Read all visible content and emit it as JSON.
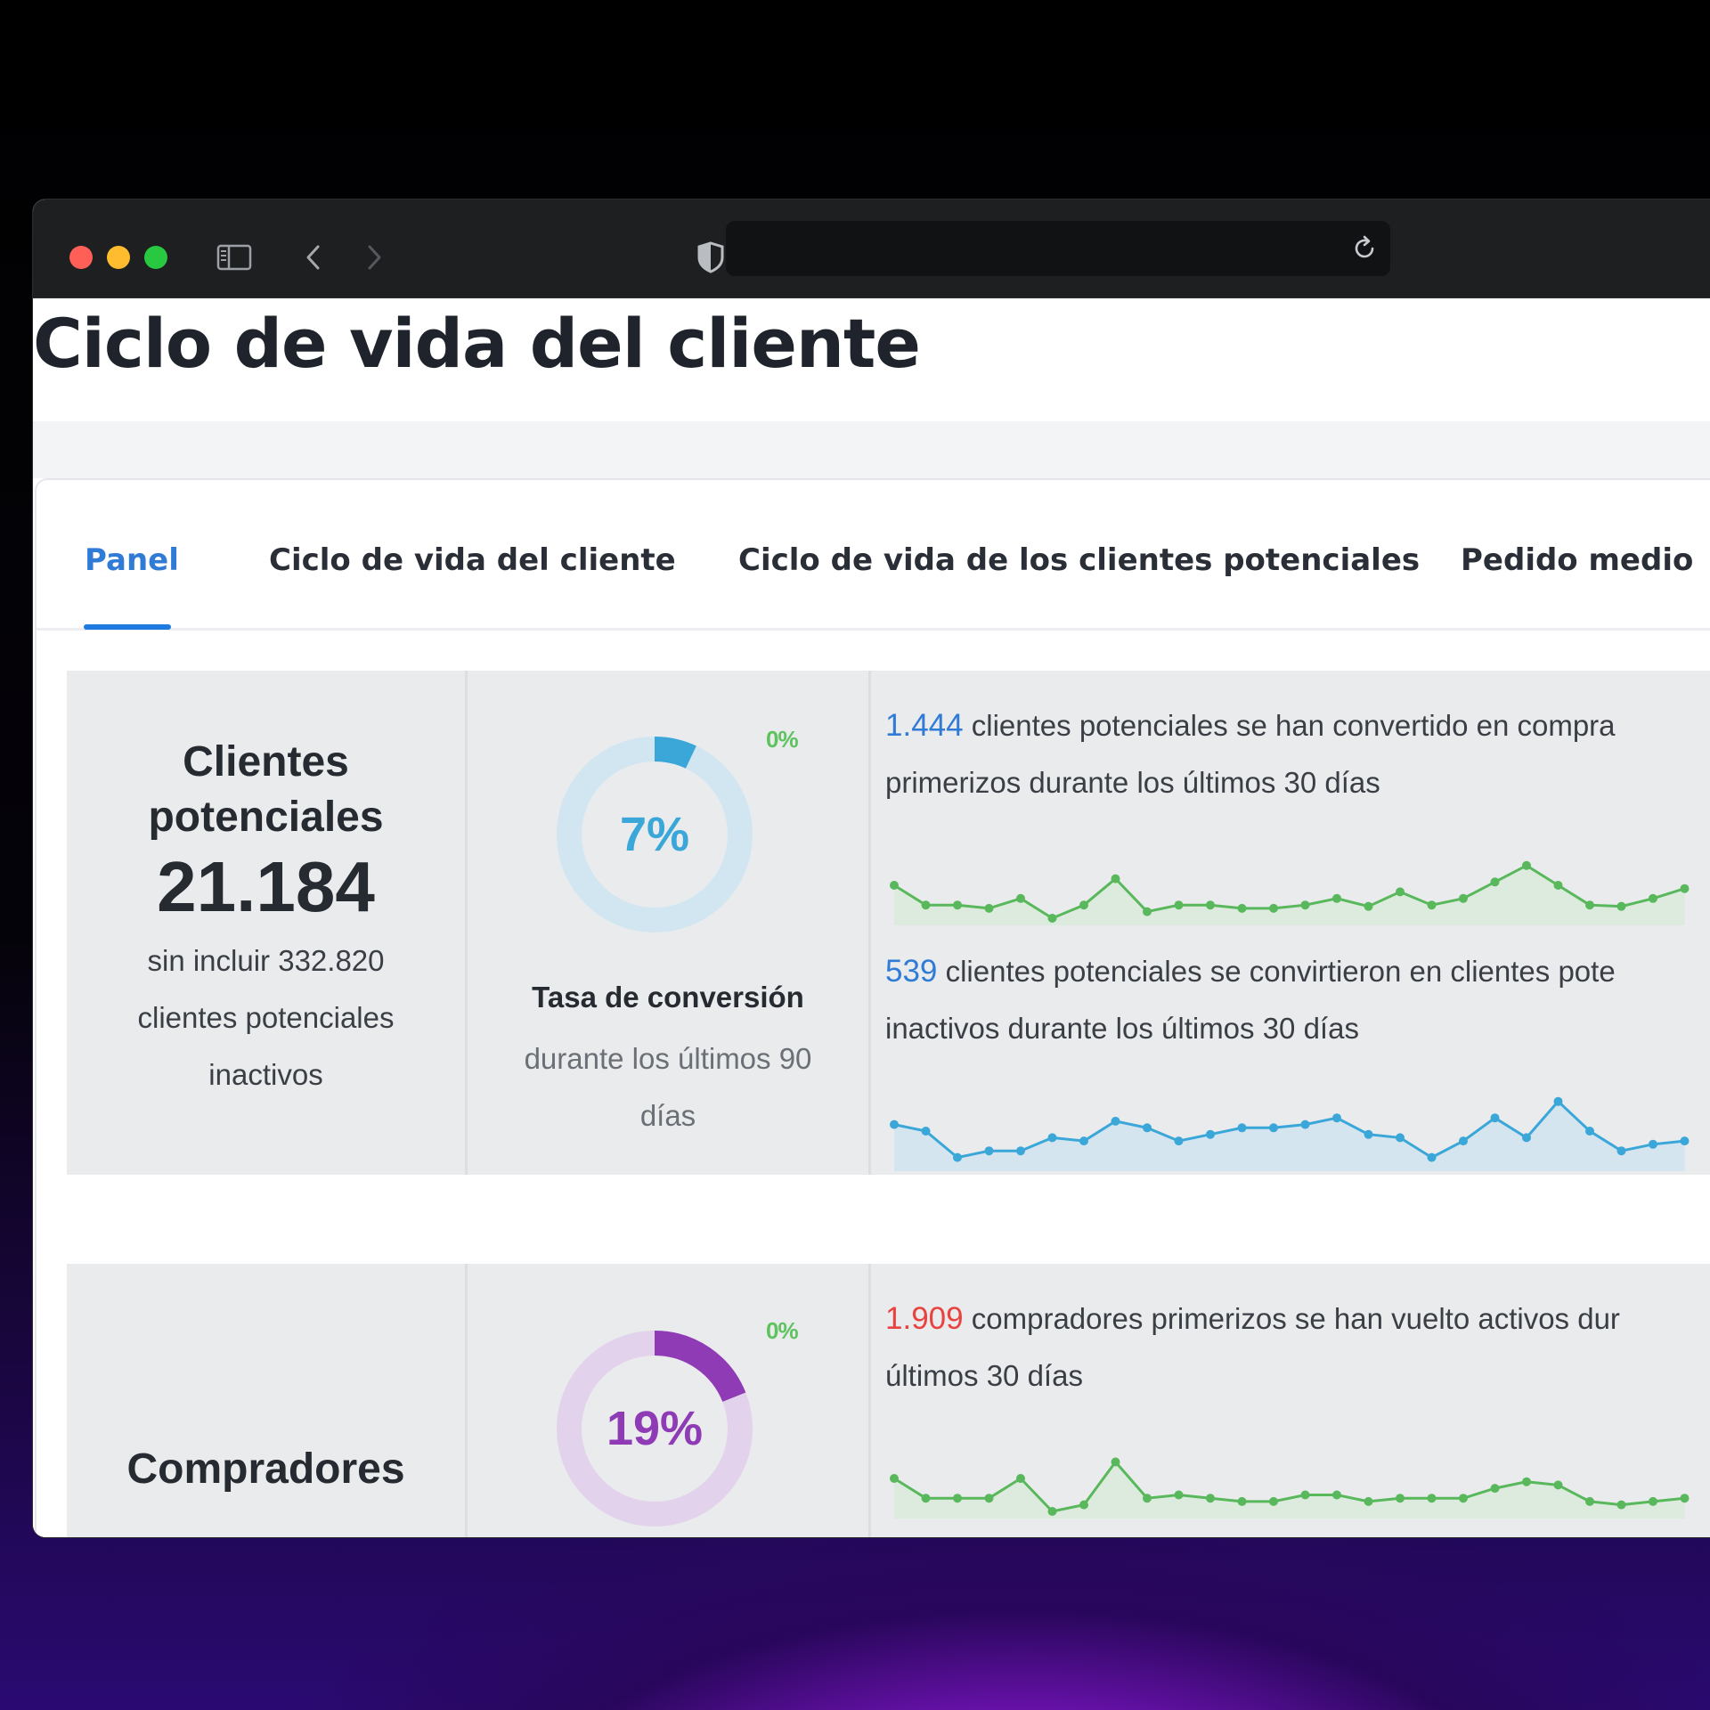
{
  "page": {
    "title": "Ciclo de vida del cliente"
  },
  "tabs": [
    {
      "label": "Panel",
      "active": true
    },
    {
      "label": "Ciclo de vida del cliente",
      "active": false
    },
    {
      "label": "Ciclo de vida de los clientes potenciales",
      "active": false
    },
    {
      "label": "Pedido medio",
      "active": false
    }
  ],
  "panel_leads": {
    "label_line1": "Clientes",
    "label_line2": "potenciales",
    "total": "21.184",
    "sub_line1": "sin incluir 332.820",
    "sub_line2": "clientes potenciales",
    "sub_line3": "inactivos",
    "conversion": {
      "percent_label": "7%",
      "percent": 7,
      "delta": "0%",
      "title": "Tasa de conversión",
      "subtitle_line1": "durante los últimos 90",
      "subtitle_line2": "días",
      "color": "#3aa7d8",
      "track_color": "#d1e6f1"
    },
    "stat1": {
      "number": "1.444",
      "text_line1": " clientes potenciales se han convertido en compra",
      "text_line2": "primerizos durante los últimos 30 días",
      "number_color": "#2f7bd6",
      "spark_color": "#59b85c",
      "spark_fill": "#dcebdd",
      "spark_values": [
        5,
        2,
        2,
        1.5,
        3,
        0,
        2,
        6,
        1,
        2,
        2,
        1.5,
        1.5,
        2,
        3,
        1.8,
        4,
        2,
        3,
        5.5,
        8,
        5,
        2,
        1.8,
        3,
        4.5
      ]
    },
    "stat2": {
      "number": "539",
      "text_line1": " clientes potenciales se convirtieron en clientes pote",
      "text_line2": "inactivos durante los últimos 30 días",
      "number_color": "#2f7bd6",
      "spark_color": "#3aa7d8",
      "spark_fill": "#d4e5ef",
      "spark_values": [
        6,
        5,
        1,
        2,
        2,
        4,
        3.5,
        6.5,
        5.5,
        3.5,
        4.5,
        5.5,
        5.5,
        6,
        7,
        4.5,
        4,
        1,
        3.5,
        7,
        4,
        9.5,
        5,
        2,
        3,
        3.5
      ]
    }
  },
  "panel_buyers": {
    "label": "Compradores",
    "conversion": {
      "percent_label": "19%",
      "percent": 19,
      "delta": "0%",
      "color": "#8e3bb5",
      "track_color": "#e3d2ec"
    },
    "stat1": {
      "number": "1.909",
      "text_line1": " compradores primerizos se han vuelto activos dur",
      "text_line2": "últimos 30 días",
      "number_color": "#e8433f",
      "spark_color": "#59b85c",
      "spark_fill": "#dcebdd",
      "spark_values": [
        5,
        2,
        2,
        2,
        5,
        0,
        1,
        7.5,
        2,
        2.5,
        2,
        1.5,
        1.5,
        2.5,
        2.5,
        1.5,
        2,
        2,
        2,
        3.5,
        4.5,
        4,
        1.5,
        1,
        1.5,
        2
      ]
    }
  }
}
